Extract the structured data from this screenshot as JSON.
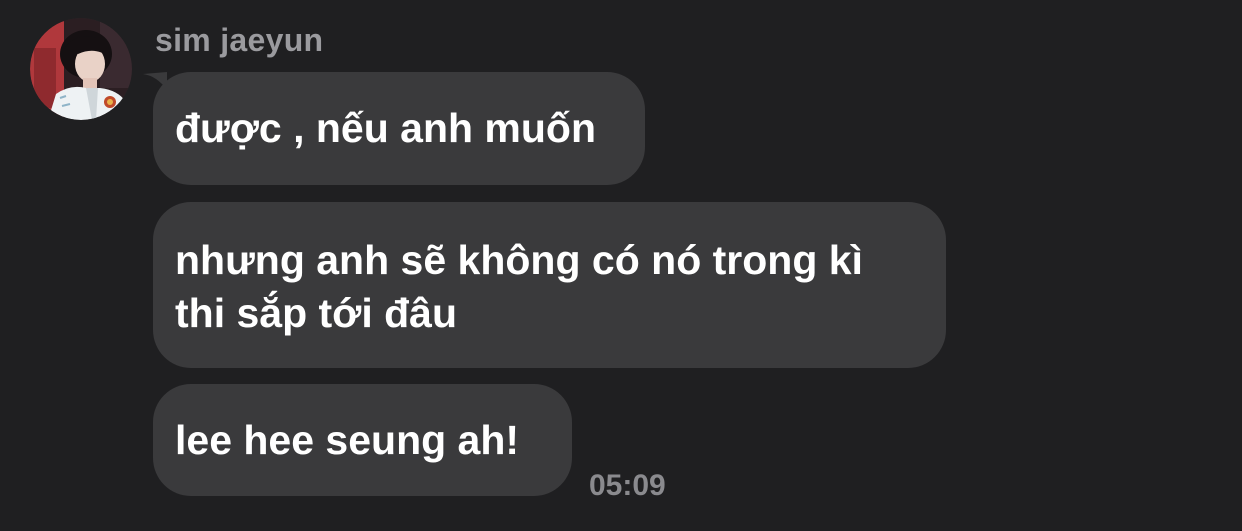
{
  "conversation": {
    "sender_name": "sim jaeyun",
    "avatar_icon": "profile-photo-avatar",
    "messages": [
      {
        "lines": [
          "được , nếu anh muốn"
        ]
      },
      {
        "lines": [
          "nhưng anh sẽ không có nó trong kì",
          "thi sắp tới đâu"
        ]
      },
      {
        "lines": [
          "lee hee seung ah!"
        ]
      }
    ],
    "timestamp": "05:09"
  },
  "colors": {
    "background": "#1f1f21",
    "bubble": "#3a3a3c",
    "message_text": "#ffffff",
    "sender_text": "#9a9a9e",
    "timestamp_text": "#8a8a8e"
  }
}
